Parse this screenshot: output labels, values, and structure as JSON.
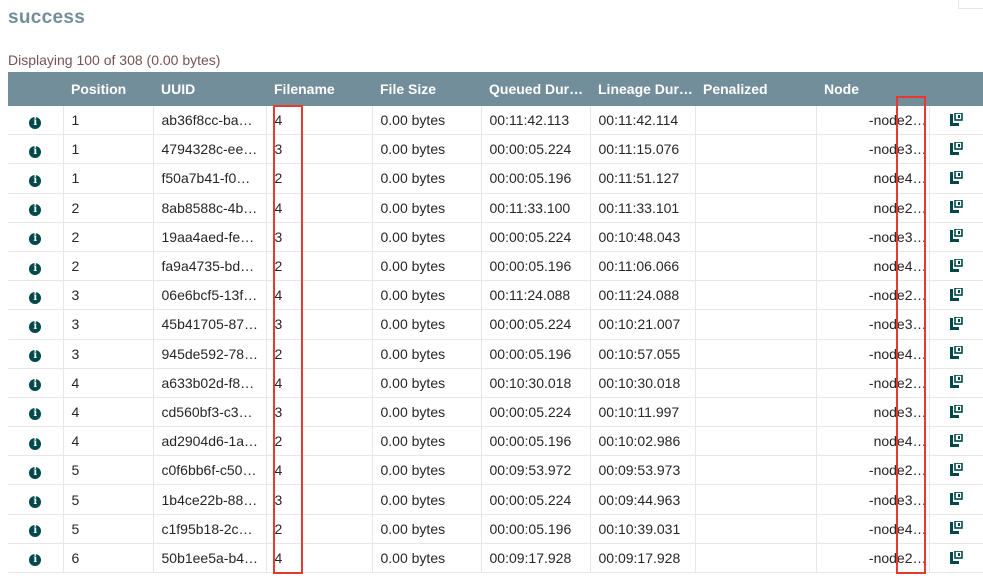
{
  "title": "success",
  "summary": "Displaying 100 of 308 (0.00 bytes)",
  "columns": [
    "",
    "Position",
    "UUID",
    "Filename",
    "File Size",
    "Queued Dura…",
    "Lineage Dur…",
    "Penalized",
    "Node",
    ""
  ],
  "icons": {
    "info": "info-icon",
    "provenance": "provenance-icon"
  },
  "colors": {
    "header_bg": "#728e9b",
    "title": "#728e9b",
    "summary": "#775351",
    "icon": "#004849",
    "highlight": "#e8392f"
  },
  "rows": [
    {
      "info": "i",
      "position": "1",
      "uuid": "ab36f8cc-ba…",
      "filename": "4",
      "size": "0.00 bytes",
      "queued": "00:11:42.113",
      "lineage": "00:11:42.114",
      "penalized": "",
      "node": "-node2…"
    },
    {
      "info": "i",
      "position": "1",
      "uuid": "4794328c-ee…",
      "filename": "3",
      "size": "0.00 bytes",
      "queued": "00:00:05.224",
      "lineage": "00:11:15.076",
      "penalized": "",
      "node": "-node3…"
    },
    {
      "info": "i",
      "position": "1",
      "uuid": "f50a7b41-f0…",
      "filename": "2",
      "size": "0.00 bytes",
      "queued": "00:00:05.196",
      "lineage": "00:11:51.127",
      "penalized": "",
      "node": "node4…"
    },
    {
      "info": "i",
      "position": "2",
      "uuid": "8ab8588c-4b…",
      "filename": "4",
      "size": "0.00 bytes",
      "queued": "00:11:33.100",
      "lineage": "00:11:33.101",
      "penalized": "",
      "node": "node2…"
    },
    {
      "info": "i",
      "position": "2",
      "uuid": "19aa4aed-fe…",
      "filename": "3",
      "size": "0.00 bytes",
      "queued": "00:00:05.224",
      "lineage": "00:10:48.043",
      "penalized": "",
      "node": "-node3…"
    },
    {
      "info": "i",
      "position": "2",
      "uuid": "fa9a4735-bd…",
      "filename": "2",
      "size": "0.00 bytes",
      "queued": "00:00:05.196",
      "lineage": "00:11:06.066",
      "penalized": "",
      "node": "node4…"
    },
    {
      "info": "i",
      "position": "3",
      "uuid": "06e6bcf5-13f…",
      "filename": "4",
      "size": "0.00 bytes",
      "queued": "00:11:24.088",
      "lineage": "00:11:24.088",
      "penalized": "",
      "node": "-node2…"
    },
    {
      "info": "i",
      "position": "3",
      "uuid": "45b41705-87…",
      "filename": "3",
      "size": "0.00 bytes",
      "queued": "00:00:05.224",
      "lineage": "00:10:21.007",
      "penalized": "",
      "node": "-node3…"
    },
    {
      "info": "i",
      "position": "3",
      "uuid": "945de592-78…",
      "filename": "2",
      "size": "0.00 bytes",
      "queued": "00:00:05.196",
      "lineage": "00:10:57.055",
      "penalized": "",
      "node": "-node4…"
    },
    {
      "info": "i",
      "position": "4",
      "uuid": "a633b02d-f8…",
      "filename": "4",
      "size": "0.00 bytes",
      "queued": "00:10:30.018",
      "lineage": "00:10:30.018",
      "penalized": "",
      "node": "-node2…"
    },
    {
      "info": "i",
      "position": "4",
      "uuid": "cd560bf3-c3…",
      "filename": "3",
      "size": "0.00 bytes",
      "queued": "00:00:05.224",
      "lineage": "00:10:11.997",
      "penalized": "",
      "node": "node3…"
    },
    {
      "info": "i",
      "position": "4",
      "uuid": "ad2904d6-1a…",
      "filename": "2",
      "size": "0.00 bytes",
      "queued": "00:00:05.196",
      "lineage": "00:10:02.986",
      "penalized": "",
      "node": "node4…"
    },
    {
      "info": "i",
      "position": "5",
      "uuid": "c0f6bb6f-c50…",
      "filename": "4",
      "size": "0.00 bytes",
      "queued": "00:09:53.972",
      "lineage": "00:09:53.973",
      "penalized": "",
      "node": "-node2…"
    },
    {
      "info": "i",
      "position": "5",
      "uuid": "1b4ce22b-88…",
      "filename": "3",
      "size": "0.00 bytes",
      "queued": "00:00:05.224",
      "lineage": "00:09:44.963",
      "penalized": "",
      "node": "-node3…"
    },
    {
      "info": "i",
      "position": "5",
      "uuid": "c1f95b18-2c…",
      "filename": "2",
      "size": "0.00 bytes",
      "queued": "00:00:05.196",
      "lineage": "00:10:39.031",
      "penalized": "",
      "node": "-node4…"
    },
    {
      "info": "i",
      "position": "6",
      "uuid": "50b1ee5a-b4…",
      "filename": "4",
      "size": "0.00 bytes",
      "queued": "00:09:17.928",
      "lineage": "00:09:17.928",
      "penalized": "",
      "node": "-node2…"
    }
  ]
}
